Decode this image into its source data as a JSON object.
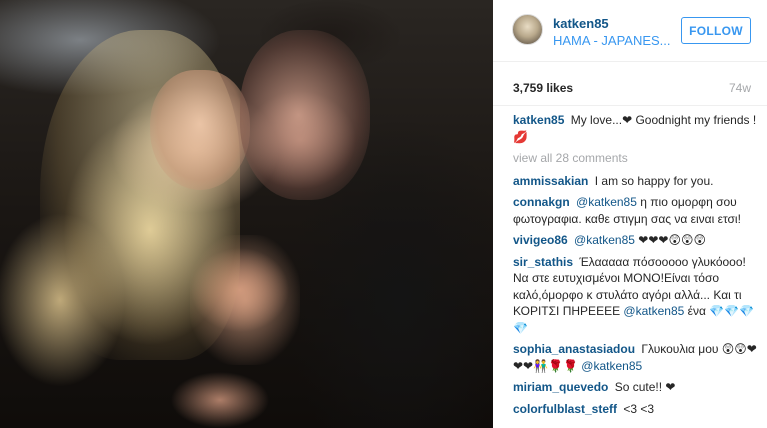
{
  "post": {
    "username": "katken85",
    "location": "HAMA - JAPANES...",
    "follow_label": "FOLLOW",
    "likes": "3,759 likes",
    "age": "74w",
    "caption": {
      "user": "katken85",
      "text": "My love...❤ Goodnight my friends !💋"
    },
    "view_all": "view all 28 comments",
    "comments": [
      {
        "user": "ammissakian",
        "mention": "",
        "text": "I am so happy for you."
      },
      {
        "user": "connakgn",
        "mention": "@katken85",
        "text": "η πιο ομορφη σου φωτογραφια. καθε στιγμη σας να ειναι ετσι!"
      },
      {
        "user": "vivigeo86",
        "mention": "@katken85",
        "text": "❤❤❤😲😲😲"
      },
      {
        "user": "sir_stathis",
        "mention": "",
        "text": "Έλααααα πόσοοοοο γλυκόοοο! Να στε ευτυχισμένοι ΜΟΝΟ!Είναι τόσο καλό,όμορφο κ στυλάτο αγόρι αλλά... Και τι ΚΟΡΙΤΣΙ ΠΗΡΕΕΕΕ",
        "after_mention": "@katken85",
        "tail": "ένα 💎💎💎💎"
      },
      {
        "user": "sophia_anastasiadou",
        "mention": "",
        "text": "Γλυκουλια μου 😲😲❤❤❤👫🌹🌹",
        "after_mention": "@katken85",
        "tail": ""
      },
      {
        "user": "miriam_quevedo",
        "mention": "",
        "text": "So cute!! ❤"
      },
      {
        "user": "colorfulblast_steff",
        "mention": "",
        "text": "<3 <3"
      }
    ]
  }
}
